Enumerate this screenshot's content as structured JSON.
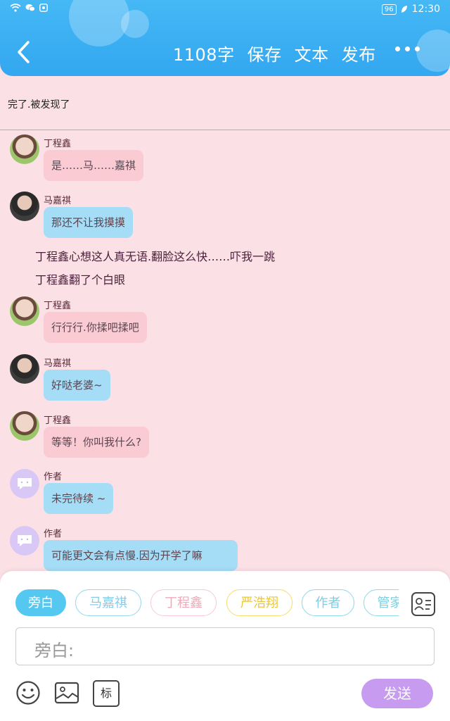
{
  "status_bar": {
    "battery": "96",
    "time": "12:30"
  },
  "nav": {
    "back_icon": "chevron-left-icon",
    "word_count": "1108字",
    "save_label": "保存",
    "text_label": "文本",
    "publish_label": "发布",
    "more_icon": "more-horizontal-icon"
  },
  "chapter": {
    "title": "完了.被发现了"
  },
  "messages": [
    {
      "type": "chat",
      "sender": "丁程鑫",
      "text": "是……马……嘉祺"
    },
    {
      "type": "chat",
      "sender": "马嘉祺",
      "text": "那还不让我摸摸"
    },
    {
      "type": "narration",
      "text": "丁程鑫心想这人真无语.翻脸这么快……吓我一跳"
    },
    {
      "type": "narration",
      "text": "丁程鑫翻了个白眼"
    },
    {
      "type": "chat",
      "sender": "丁程鑫",
      "text": "行行行.你揉吧揉吧"
    },
    {
      "type": "chat",
      "sender": "马嘉祺",
      "text": "好哒老婆~"
    },
    {
      "type": "chat",
      "sender": "丁程鑫",
      "text": "等等！你叫我什么?"
    },
    {
      "type": "chat",
      "sender": "作者",
      "text": "未完待续 ~"
    },
    {
      "type": "chat",
      "sender": "作者",
      "text": "可能更文会有点慢.因为开学了嘛"
    }
  ],
  "composer": {
    "roles": [
      "旁白",
      "马嘉祺",
      "丁程鑫",
      "严浩翔",
      "作者",
      "管家"
    ],
    "input_placeholder": "旁白:",
    "send_label": "发送",
    "tool_tag_label": "标"
  },
  "colors": {
    "header": "#33a7f0",
    "background": "#fbe1e6",
    "bubble_pink": "#fbcbd3",
    "bubble_blue": "#a5dcf6",
    "send": "#c69bf0"
  }
}
